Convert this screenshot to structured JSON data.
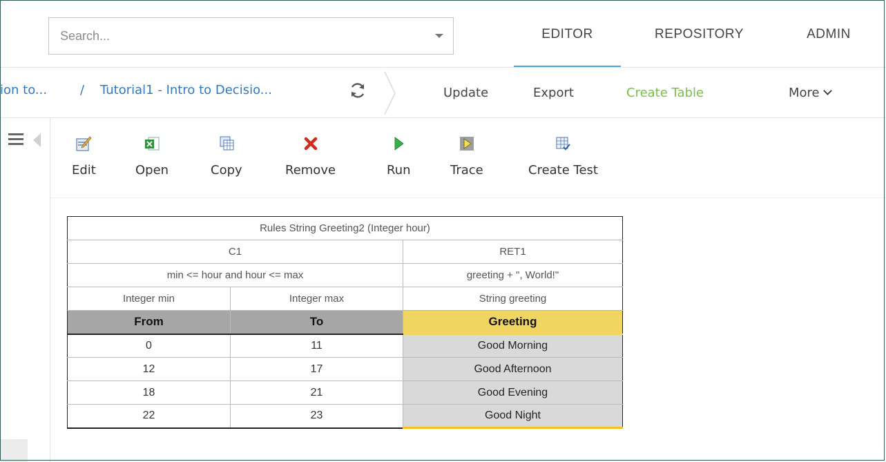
{
  "header": {
    "search_placeholder": "Search...",
    "nav": {
      "editor": "EDITOR",
      "repository": "REPOSITORY",
      "admin": "ADMIN"
    },
    "active_tab": "EDITOR"
  },
  "breadcrumb": {
    "item1": "ion to...",
    "separator": "/",
    "item2": "Tutorial1 - Intro to Decisio..."
  },
  "actions": {
    "update": "Update",
    "export": "Export",
    "create_table": "Create Table",
    "more": "More"
  },
  "toolbar": {
    "edit": "Edit",
    "open": "Open",
    "copy": "Copy",
    "remove": "Remove",
    "run": "Run",
    "trace": "Trace",
    "create_test": "Create Test"
  },
  "table": {
    "title": "Rules String Greeting2 (Integer hour)",
    "c1": "C1",
    "ret1": "RET1",
    "condition_expr": "min <= hour and hour <= max",
    "return_expr": "greeting + \", World!\"",
    "param_min": "Integer min",
    "param_max": "Integer max",
    "param_greeting": "String greeting",
    "header_from": "From",
    "header_to": "To",
    "header_greeting": "Greeting",
    "rows": [
      {
        "from": "0",
        "to": "11",
        "greeting": "Good Morning"
      },
      {
        "from": "12",
        "to": "17",
        "greeting": "Good Afternoon"
      },
      {
        "from": "18",
        "to": "21",
        "greeting": "Good Evening"
      },
      {
        "from": "22",
        "to": "23",
        "greeting": "Good Night"
      }
    ]
  },
  "colors": {
    "accent_blue": "#4aa3df",
    "link_blue": "#2e7bc4",
    "create_green": "#7bbf4a",
    "header_gray": "#a6a6a6",
    "header_yellow": "#f1d561",
    "return_cell_gray": "#d9d9d9"
  }
}
